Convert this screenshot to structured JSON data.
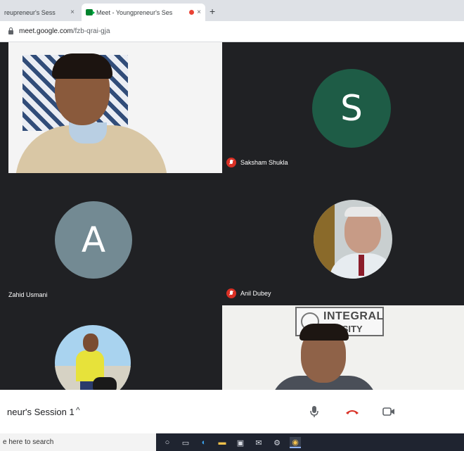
{
  "browser": {
    "tabs": [
      {
        "label": "reupreneur's Sess",
        "active": false
      },
      {
        "label": "Meet - Youngpreneur's Ses",
        "active": true,
        "recording": true
      }
    ],
    "new_tab": "+",
    "close_glyph": "×",
    "url_host": "meet.google.com",
    "url_path": "/fzb-qrai-gja"
  },
  "participants": [
    {
      "name": "",
      "kind": "video"
    },
    {
      "name": "Saksham Shukla",
      "initial": "S",
      "muted": true,
      "avatar_color": "#1e5c46"
    },
    {
      "name": "Zahid Usmani",
      "initial": "A",
      "muted": false,
      "avatar_color": "#738a93"
    },
    {
      "name": "Anil Dubey",
      "muted": true,
      "kind": "photo"
    },
    {
      "name": "",
      "kind": "photo"
    },
    {
      "name": "",
      "kind": "video",
      "logo_text": [
        "INTEGRAL",
        "VERSITY"
      ]
    }
  ],
  "meeting": {
    "title": "neur's Session 1",
    "caret": "^",
    "controls": [
      "mic-icon",
      "hangup-icon",
      "camera-icon"
    ],
    "hangup_color": "#d93025"
  },
  "taskbar": {
    "search_placeholder": "e here to search",
    "icons": [
      "cortana-icon",
      "task-view-icon",
      "edge-icon",
      "file-explorer-icon",
      "store-icon",
      "mail-icon",
      "settings-icon",
      "chrome-icon"
    ]
  }
}
